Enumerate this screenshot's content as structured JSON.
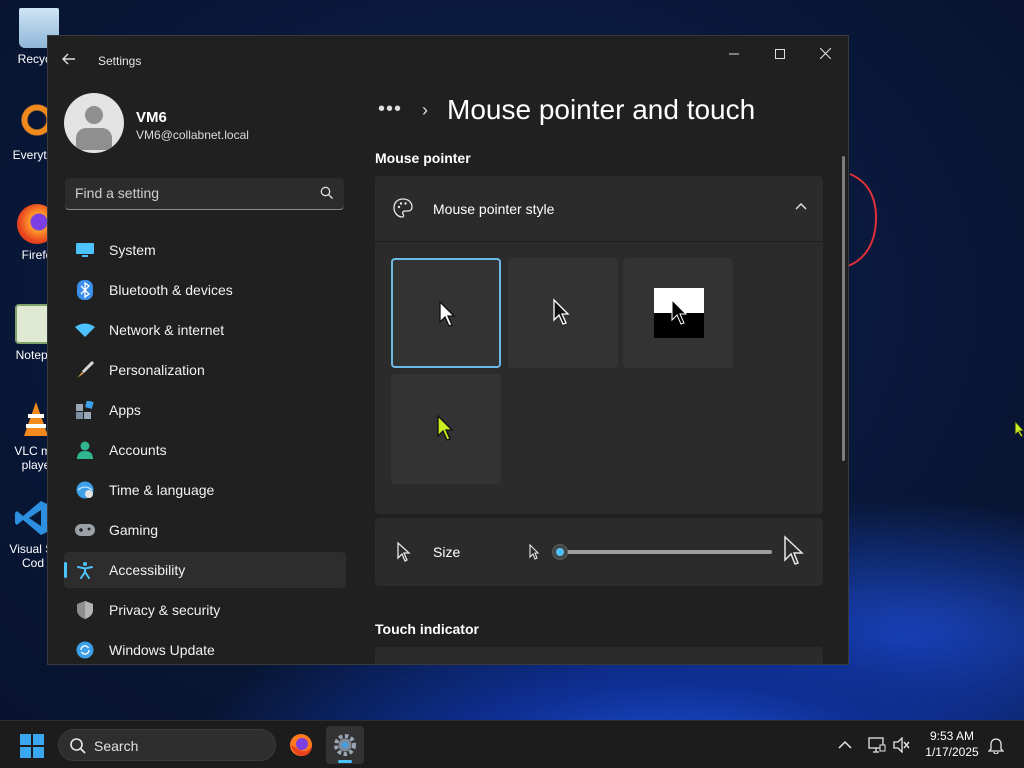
{
  "desktop": {
    "icons": [
      {
        "label": "Recycle",
        "icon": "recycle-bin-icon"
      },
      {
        "label": "Everyth",
        "icon": "everything-search-icon"
      },
      {
        "label": "Firefo",
        "icon": "firefox-icon"
      },
      {
        "label": "Notepa",
        "icon": "notepad-icon"
      },
      {
        "label": "VLC me playe",
        "icon": "vlc-icon"
      },
      {
        "label": "Visual St Cod",
        "icon": "vscode-icon"
      }
    ]
  },
  "window": {
    "title": "Settings",
    "controls": {
      "minimize": "—",
      "maximize": "☐",
      "close": "✕"
    }
  },
  "profile": {
    "name": "VM6",
    "email": "VM6@collabnet.local"
  },
  "search": {
    "placeholder": "Find a setting"
  },
  "nav": {
    "items": [
      {
        "label": "System",
        "icon": "system-monitor-icon",
        "color": "#4cc2ff"
      },
      {
        "label": "Bluetooth & devices",
        "icon": "bluetooth-icon",
        "color": "#3b8eea"
      },
      {
        "label": "Network & internet",
        "icon": "wifi-icon",
        "color": "#4cc2ff"
      },
      {
        "label": "Personalization",
        "icon": "paintbrush-icon",
        "color": "#e8a54b"
      },
      {
        "label": "Apps",
        "icon": "apps-icon",
        "color": "#7c8ea3"
      },
      {
        "label": "Accounts",
        "icon": "person-icon",
        "color": "#2fb58f"
      },
      {
        "label": "Time & language",
        "icon": "globe-clock-icon",
        "color": "#3ea0e8"
      },
      {
        "label": "Gaming",
        "icon": "gamepad-icon",
        "color": "#9aa0a6"
      },
      {
        "label": "Accessibility",
        "icon": "accessibility-icon",
        "color": "#4cc2ff"
      },
      {
        "label": "Privacy & security",
        "icon": "shield-icon",
        "color": "#8e8e8e"
      },
      {
        "label": "Windows Update",
        "icon": "update-icon",
        "color": "#3ea0e8"
      }
    ],
    "active": "Accessibility"
  },
  "main": {
    "breadcrumb_more": "•••",
    "breadcrumb_sep": "›",
    "title": "Mouse pointer and touch",
    "section_pointer": "Mouse pointer",
    "pointer_style": {
      "label": "Mouse pointer style",
      "expanded": true,
      "options": [
        {
          "name": "white",
          "selected": true
        },
        {
          "name": "black",
          "selected": false
        },
        {
          "name": "inverted",
          "selected": false
        },
        {
          "name": "custom",
          "selected": false,
          "color": "#c8f020"
        }
      ]
    },
    "size": {
      "label": "Size",
      "value": 1
    },
    "section_touch": "Touch indicator"
  },
  "taskbar": {
    "search_label": "Search",
    "apps": [
      {
        "name": "firefox",
        "icon": "firefox-icon"
      },
      {
        "name": "settings",
        "icon": "gear-icon",
        "active": true
      }
    ],
    "time": "9:53 AM",
    "date": "1/17/2025"
  },
  "colors": {
    "accent": "#4cc2ff",
    "window_bg": "#202020",
    "card_bg": "#2b2b2b"
  }
}
